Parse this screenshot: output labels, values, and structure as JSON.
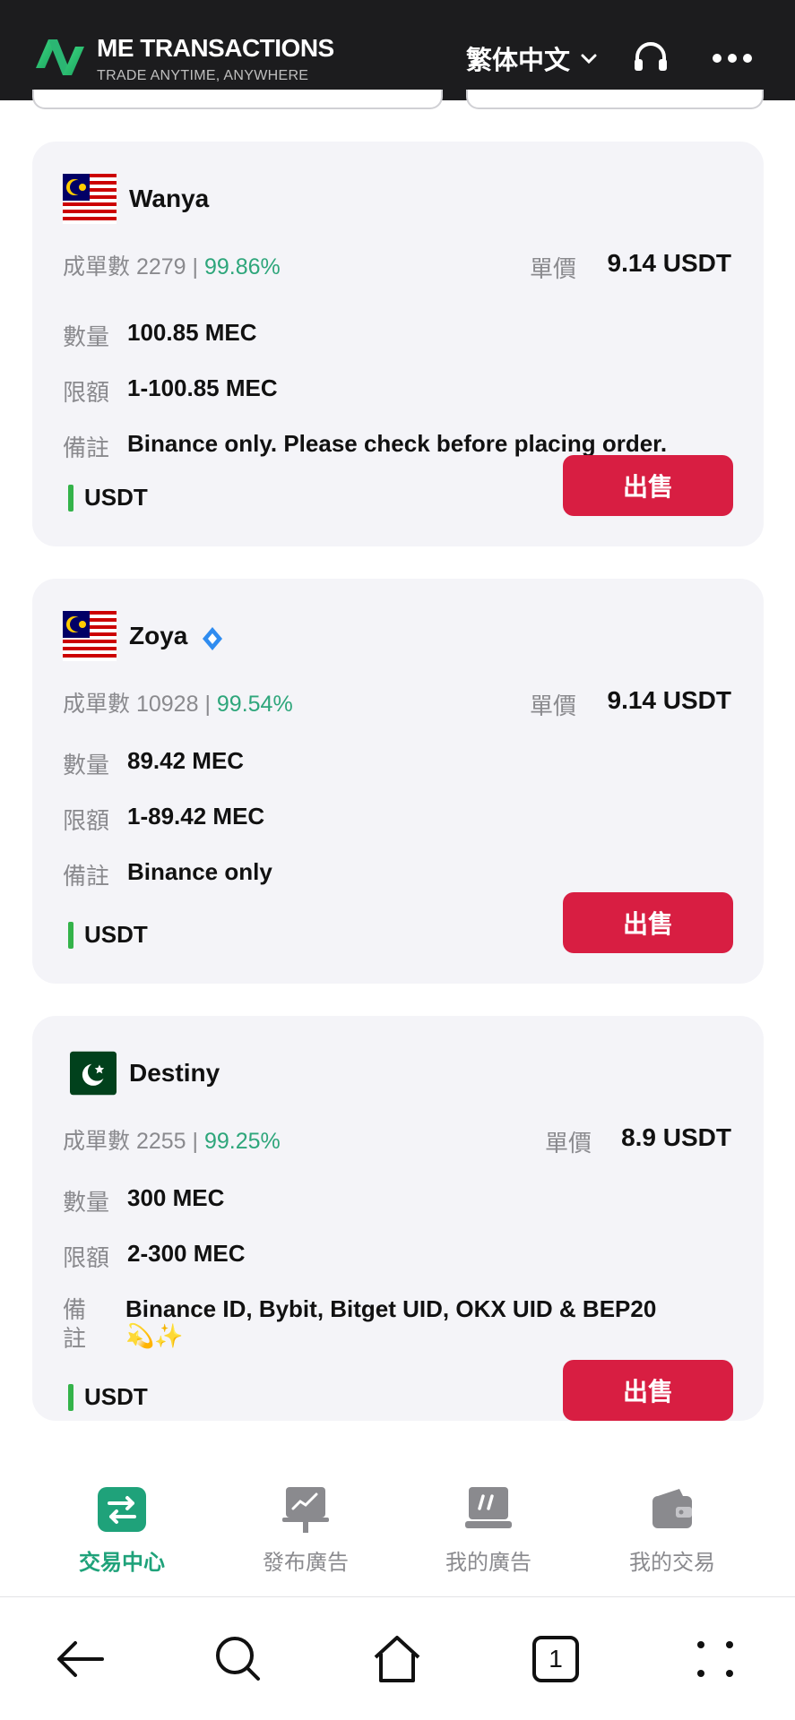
{
  "header": {
    "brand_title": "ME TRANSACTIONS",
    "brand_subtitle": "TRADE ANYTIME, ANYWHERE",
    "language": "繁体中文"
  },
  "labels": {
    "orders": "成單數",
    "price": "單價",
    "quantity": "數量",
    "limit": "限額",
    "remark": "備註"
  },
  "listings": [
    {
      "name": "Wanya",
      "flag": "malaysia-flag",
      "orders": "2279",
      "rate": "99.86%",
      "price": "9.14 USDT",
      "quantity": "100.85 MEC",
      "limit": "1-100.85 MEC",
      "remark": "Binance only. Please check before placing order.",
      "payment": "USDT",
      "action": "出售"
    },
    {
      "name": "Zoya",
      "flag": "malaysia-flag",
      "verified": true,
      "orders": "10928",
      "rate": "99.54%",
      "price": "9.14 USDT",
      "quantity": "89.42 MEC",
      "limit": "1-89.42 MEC",
      "remark": "Binance only",
      "payment": "USDT",
      "action": "出售"
    },
    {
      "name": "Destiny",
      "flag": "pakistan-flag",
      "orders": "2255",
      "rate": "99.25%",
      "price": "8.9 USDT",
      "quantity": "300 MEC",
      "limit": "2-300 MEC",
      "remark_label_line1": "備",
      "remark_label_line2": "註",
      "remark": "Binance ID, Bybit, Bitget UID, OKX UID & BEP20",
      "remark_emoji": "💫✨",
      "payment": "USDT",
      "action": "出售"
    }
  ],
  "bottom_nav": {
    "items": [
      {
        "label": "交易中心",
        "icon": "exchange-icon",
        "active": true
      },
      {
        "label": "發布廣告",
        "icon": "chart-board-icon"
      },
      {
        "label": "我的廣告",
        "icon": "ad-board-icon"
      },
      {
        "label": "我的交易",
        "icon": "wallet-icon"
      }
    ]
  },
  "system_nav": {
    "tab_count": "1"
  },
  "colors": {
    "header_bg": "#1c1c1e",
    "card_bg": "#f4f4f8",
    "sell_button": "#d81e42",
    "rate_green": "#2ea67b",
    "active_nav": "#1fa27a",
    "payment_bar": "#34b34a"
  }
}
